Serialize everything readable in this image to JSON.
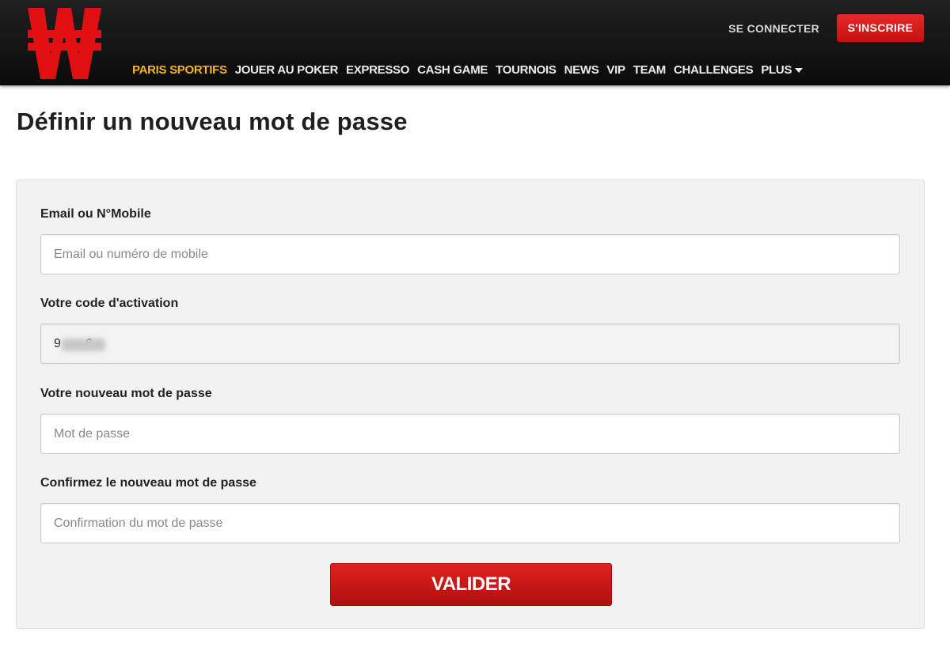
{
  "brand": {
    "color": "#e01010",
    "logo_icon": "w-logo-icon"
  },
  "header": {
    "login_label": "SE CONNECTER",
    "signup_label": "S'INSCRIRE"
  },
  "nav": {
    "items": [
      {
        "label": "PARIS SPORTIFS",
        "active": true
      },
      {
        "label": "JOUER AU POKER"
      },
      {
        "label": "EXPRESSO"
      },
      {
        "label": "CASH GAME"
      },
      {
        "label": "TOURNOIS"
      },
      {
        "label": "NEWS"
      },
      {
        "label": "VIP"
      },
      {
        "label": "TEAM"
      },
      {
        "label": "CHALLENGES"
      },
      {
        "label": "PLUS",
        "has_dropdown": true
      }
    ]
  },
  "page": {
    "title": "Définir un nouveau mot de passe"
  },
  "form": {
    "email": {
      "label": "Email ou N°Mobile",
      "placeholder": "Email ou numéro de mobile",
      "value": ""
    },
    "code": {
      "label": "Votre code d'activation",
      "value": "9       6"
    },
    "password": {
      "label": "Votre nouveau mot de passe",
      "placeholder": "Mot de passe"
    },
    "confirm": {
      "label": "Confirmez le nouveau mot de passe",
      "placeholder": "Confirmation du mot de passe"
    },
    "submit_label": "VALIDER"
  }
}
